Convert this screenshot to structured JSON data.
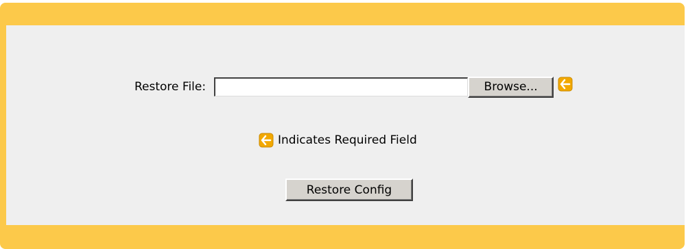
{
  "form": {
    "restore_file_label": "Restore File:",
    "restore_file_value": "",
    "browse_label": "Browse...",
    "required_legend": "Indicates Required Field",
    "restore_button_label": "Restore Config"
  },
  "icons": {
    "required_marker": "required-field-arrow-icon"
  },
  "colors": {
    "frame": "#fcc94a",
    "panel": "#efefef",
    "required_icon": "#f2a800"
  }
}
